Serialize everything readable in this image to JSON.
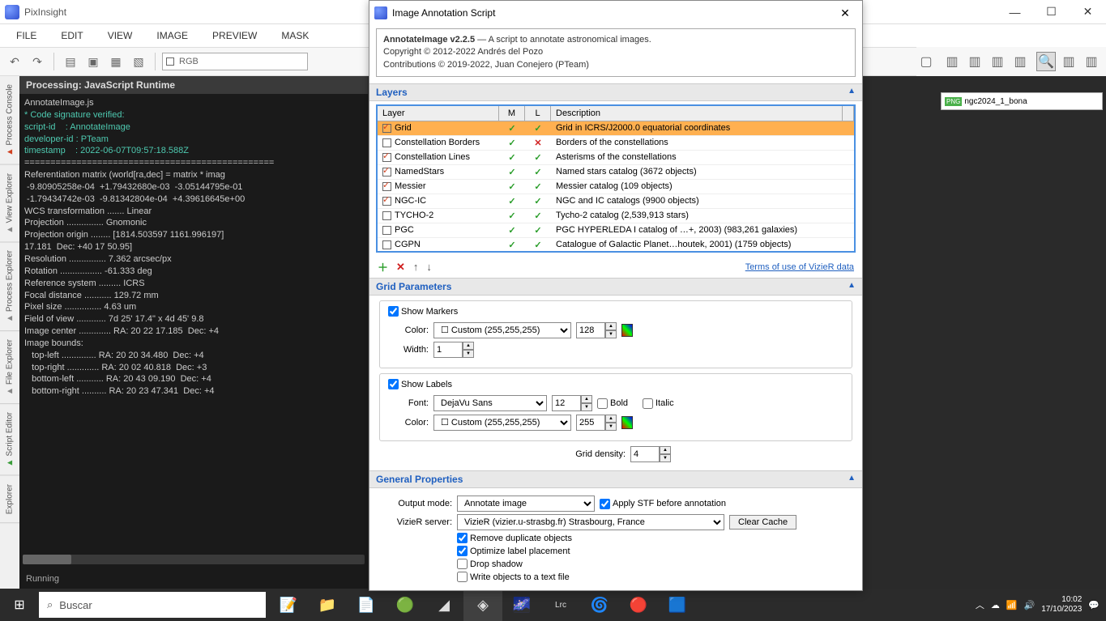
{
  "app": {
    "title": "PixInsight"
  },
  "menu": [
    "FILE",
    "EDIT",
    "VIEW",
    "IMAGE",
    "PREVIEW",
    "MASK"
  ],
  "toolbar_combo": "RGB",
  "side_tabs": [
    "Process Console",
    "View Explorer",
    "Process Explorer",
    "File Explorer",
    "Script Editor",
    "Explorer"
  ],
  "console": {
    "header": "Processing: JavaScript Runtime",
    "lines": [
      "AnnotateImage.js",
      "* Code signature verified:",
      "script-id    : AnnotateImage",
      "developer-id : PTeam",
      "timestamp    : 2022-06-07T09:57:18.588Z",
      "",
      "================================================",
      "Referentiation matrix (world[ra,dec] = matrix * imag",
      " -9.80905258e-04  +1.79432680e-03  -3.05144795e-01",
      " -1.79434742e-03  -9.81342804e-04  +4.39616645e+00",
      "WCS transformation ....... Linear",
      "Projection ............... Gnomonic",
      "Projection origin ........ [1814.503597 1161.996197]",
      "17.181  Dec: +40 17 50.95]",
      "Resolution ............... 7.362 arcsec/px",
      "Rotation ................. -61.333 deg",
      "Reference system ......... ICRS",
      "Focal distance ........... 129.72 mm",
      "Pixel size ............... 4.63 um",
      "Field of view ............ 7d 25' 17.4\" x 4d 45' 9.8",
      "Image center ............. RA: 20 22 17.185  Dec: +4",
      "Image bounds:",
      "   top-left .............. RA: 20 20 34.480  Dec: +4",
      "   top-right ............. RA: 20 02 40.818  Dec: +3",
      "   bottom-left ........... RA: 20 43 09.190  Dec: +4",
      "   bottom-right .......... RA: 20 23 47.341  Dec: +4"
    ],
    "status": "Running"
  },
  "dialog": {
    "title": "Image Annotation Script",
    "desc_title": "AnnotateImage v2.2.5",
    "desc_text": " — A script to annotate astronomical images.",
    "desc_copy1": "Copyright © 2012-2022 Andrés del Pozo",
    "desc_copy2": "Contributions © 2019-2022, Juan Conejero (PTeam)",
    "layers_header": "Layers",
    "table_headers": {
      "layer": "Layer",
      "m": "M",
      "l": "L",
      "desc": "Description"
    },
    "rows": [
      {
        "on": true,
        "name": "Grid",
        "m": "g",
        "l": "g",
        "desc": "Grid in ICRS/J2000.0 equatorial coordinates",
        "sel": true
      },
      {
        "on": false,
        "name": "Constellation Borders",
        "m": "g",
        "l": "r",
        "desc": "Borders of the constellations"
      },
      {
        "on": true,
        "name": "Constellation Lines",
        "m": "g",
        "l": "g",
        "desc": "Asterisms of the constellations"
      },
      {
        "on": true,
        "name": "NamedStars",
        "m": "g",
        "l": "g",
        "desc": "Named stars catalog (3672 objects)"
      },
      {
        "on": true,
        "name": "Messier",
        "m": "g",
        "l": "g",
        "desc": "Messier catalog (109 objects)"
      },
      {
        "on": true,
        "name": "NGC-IC",
        "m": "g",
        "l": "g",
        "desc": "NGC and IC catalogs (9900 objects)"
      },
      {
        "on": false,
        "name": "TYCHO-2",
        "m": "g",
        "l": "g",
        "desc": "Tycho-2 catalog (2,539,913 stars)"
      },
      {
        "on": false,
        "name": "PGC",
        "m": "g",
        "l": "g",
        "desc": "PGC HYPERLEDA I catalog of …+, 2003) (983,261 galaxies)"
      },
      {
        "on": false,
        "name": "CGPN",
        "m": "g",
        "l": "g",
        "desc": "Catalogue of Galactic Planet…houtek, 2001) (1759 objects)"
      }
    ],
    "terms_link": "Terms of use of VizieR data",
    "params_header": "Grid Parameters",
    "show_markers": "Show Markers",
    "color_label": "Color:",
    "color_value": "Custom (255,255,255)",
    "color_alpha": "128",
    "width_label": "Width:",
    "width_value": "1",
    "show_labels": "Show Labels",
    "font_label": "Font:",
    "font_value": "DejaVu Sans",
    "font_size": "12",
    "bold": "Bold",
    "italic": "Italic",
    "label_color_alpha": "255",
    "density_label": "Grid density:",
    "density_value": "4",
    "general_header": "General Properties",
    "output_mode_label": "Output mode:",
    "output_mode_value": "Annotate image",
    "apply_stf": "Apply STF before annotation",
    "vizier_label": "VizieR server:",
    "vizier_value": "VizieR (vizier.u-strasbg.fr) Strasbourg, France",
    "clear_cache": "Clear Cache",
    "opt1": "Remove duplicate objects",
    "opt2": "Optimize label placement",
    "opt3": "Drop shadow",
    "opt4": "Write objects to a text file"
  },
  "right_tile": "ngc2024_1_bona",
  "taskbar": {
    "search": "Buscar",
    "time": "10:02",
    "date": "17/10/2023"
  }
}
